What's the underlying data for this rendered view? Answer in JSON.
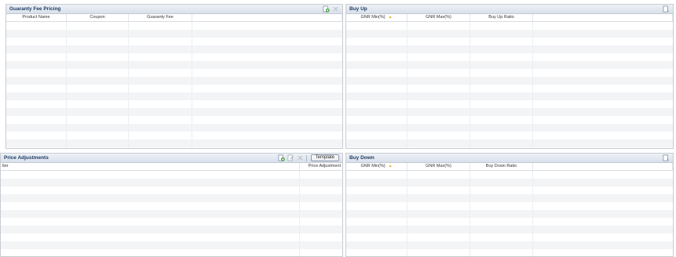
{
  "guaranty_fee_pricing": {
    "title": "Guaranty Fee Pricing",
    "icons": [
      "add-icon",
      "delete-icon"
    ],
    "columns": [
      "Product Name",
      "Coupon",
      "Guaranty Fee"
    ],
    "row_count": 17
  },
  "buy_up": {
    "title": "Buy Up",
    "icons": [
      "add-icon"
    ],
    "columns": [
      "GNR Min(%)",
      "GNR Max(%)",
      "Buy Up Ratio"
    ],
    "sort_indicator": "▲",
    "row_count": 17
  },
  "price_adjustments": {
    "title": "Price Adjustments",
    "icons": [
      "add-icon",
      "edit-icon",
      "delete-icon"
    ],
    "template_button": "Template",
    "columns": [
      "lter",
      "Price Adjustment"
    ],
    "row_count": 12
  },
  "buy_down": {
    "title": "Buy Down",
    "icons": [
      "add-icon"
    ],
    "columns": [
      "GNR Min(%)",
      "GNR Max(%)",
      "Buy Down Ratio"
    ],
    "sort_indicator": "▲",
    "row_count": 12
  },
  "colors": {
    "header_text": "#1f3b63",
    "sort_arrow": "#f0a020",
    "icon_green": "#3a9a3a"
  }
}
